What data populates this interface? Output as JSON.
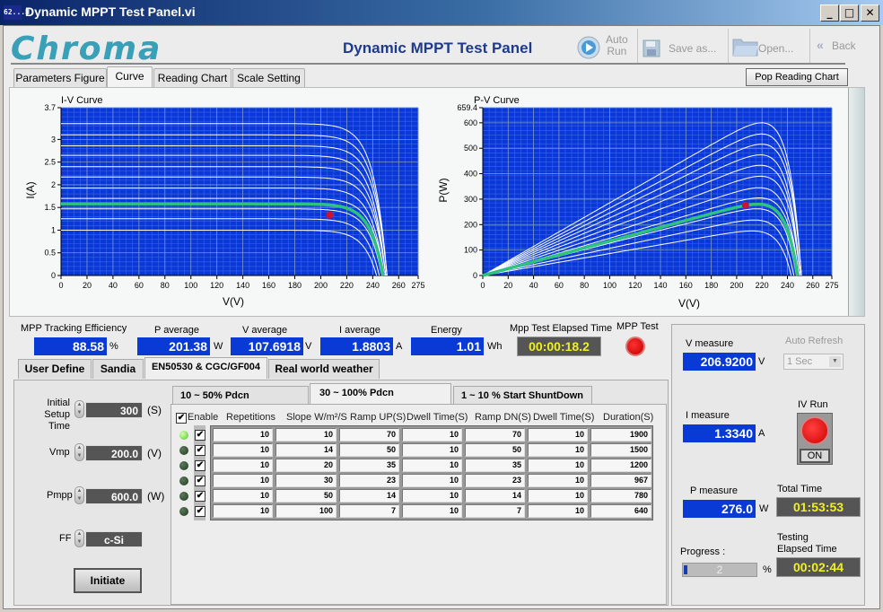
{
  "window": {
    "app_icon_text": "62...H",
    "title": "Dynamic MPPT Test Panel.vi",
    "controls": {
      "minimize": "_",
      "maximize": "□",
      "close": "✕"
    }
  },
  "header": {
    "logo": "Chroma",
    "title": "Dynamic MPPT Test Panel",
    "toolbar": [
      {
        "icon": "play-icon",
        "label_line1": "Auto",
        "label_line2": "Run"
      },
      {
        "icon": "floppy-icon",
        "label": "Save as..."
      },
      {
        "icon": "folder-icon",
        "label": "Open..."
      },
      {
        "icon": "back-chevrons-icon",
        "label": "Back"
      }
    ]
  },
  "main_tabs": [
    "Parameters Figure",
    "Curve",
    "Reading Chart",
    "Scale Setting"
  ],
  "main_tab_active": "Curve",
  "pop_button": "Pop Reading Chart",
  "chart_data": [
    {
      "type": "line",
      "title": "I-V Curve",
      "xlabel": "V(V)",
      "ylabel": "I(A)",
      "xlim": [
        0,
        275
      ],
      "ylim": [
        0,
        3.7
      ],
      "xticks": [
        "0",
        "20",
        "40",
        "60",
        "80",
        "100",
        "120",
        "140",
        "160",
        "180",
        "200",
        "220",
        "240",
        "260",
        "275"
      ],
      "yticks": [
        "0",
        "0.5",
        "1",
        "1.5",
        "2",
        "2.5",
        "3",
        "3.7"
      ],
      "grid": true,
      "background": "#0a38d8",
      "series_isc": [
        1.0,
        1.25,
        1.47,
        1.58,
        1.7,
        1.93,
        2.17,
        2.4,
        2.65,
        2.86,
        3.1,
        3.35
      ],
      "voc": [
        243,
        245,
        247,
        248,
        249,
        249,
        250,
        250,
        250,
        251,
        251,
        251
      ],
      "highlight_series_index": 3,
      "highlight_color": "#2ec27e",
      "marker": {
        "x": 207,
        "y": 1.334,
        "color": "#cc1133"
      }
    },
    {
      "type": "line",
      "title": "P-V Curve",
      "xlabel": "V(V)",
      "ylabel": "P(W)",
      "xlim": [
        0,
        275
      ],
      "ylim": [
        0,
        659.4
      ],
      "xticks": [
        "0",
        "20",
        "40",
        "60",
        "80",
        "100",
        "120",
        "140",
        "160",
        "180",
        "200",
        "220",
        "240",
        "260",
        "275"
      ],
      "yticks": [
        "0",
        "100",
        "200",
        "300",
        "400",
        "500",
        "600",
        "659.4"
      ],
      "grid": true,
      "background": "#0a38d8",
      "series_pmax": [
        175,
        218,
        262,
        280,
        305,
        345,
        390,
        433,
        474,
        516,
        556,
        600
      ],
      "highlight_series_index": 3,
      "highlight_color": "#2ec27e",
      "marker": {
        "x": 207,
        "y": 276,
        "color": "#cc1133"
      }
    }
  ],
  "readouts": {
    "efficiency": {
      "label": "MPP Tracking Efficiency",
      "value": "88.58",
      "unit": "%"
    },
    "p_average": {
      "label": "P average",
      "value": "201.38",
      "unit": "W"
    },
    "v_average": {
      "label": "V average",
      "value": "107.6918",
      "unit": "V"
    },
    "i_average": {
      "label": "I average",
      "value": "1.8803",
      "unit": "A"
    },
    "energy": {
      "label": "Energy",
      "value": "1.01",
      "unit": "Wh"
    },
    "mpp_elapsed": {
      "label": "Mpp Test Elapsed Time",
      "value": "00:00:18.2"
    },
    "mpp_test": {
      "label": "MPP Test"
    }
  },
  "mode_tabs": [
    "User Define",
    "Sandia",
    "EN50530 & CGC/GF004",
    "Real world weather"
  ],
  "mode_tab_active": "EN50530 & CGC/GF004",
  "setup": {
    "initial_setup_time": {
      "label_line1": "Initial Setup",
      "label_line2": "Time",
      "value": "300",
      "unit": "(S)"
    },
    "vmp": {
      "label": "Vmp",
      "value": "200.0",
      "unit": "(V)"
    },
    "pmpp": {
      "label": "Pmpp",
      "value": "600.0",
      "unit": "(W)"
    },
    "ff": {
      "label": "FF",
      "value": "c-Si"
    },
    "initiate": "Initiate"
  },
  "sub_tabs": [
    "10 ~ 50% Pdcn",
    "30 ~ 100% Pdcn",
    "1 ~ 10 % Start ShuntDown"
  ],
  "sub_tab_active": "30 ~ 100% Pdcn",
  "table": {
    "enable_label": "Enable",
    "columns": [
      "Repetitions",
      "Slope W/m²/S",
      "Ramp UP(S)",
      "Dwell Time(S)",
      "Ramp DN(S)",
      "Dwell Time(S)",
      "Duration(S)"
    ],
    "rows": [
      {
        "active": true,
        "enabled": true,
        "values": [
          "10",
          "10",
          "70",
          "10",
          "70",
          "10",
          "1900"
        ]
      },
      {
        "active": false,
        "enabled": true,
        "values": [
          "10",
          "14",
          "50",
          "10",
          "50",
          "10",
          "1500"
        ]
      },
      {
        "active": false,
        "enabled": true,
        "values": [
          "10",
          "20",
          "35",
          "10",
          "35",
          "10",
          "1200"
        ]
      },
      {
        "active": false,
        "enabled": true,
        "values": [
          "10",
          "30",
          "23",
          "10",
          "23",
          "10",
          "967"
        ]
      },
      {
        "active": false,
        "enabled": true,
        "values": [
          "10",
          "50",
          "14",
          "10",
          "14",
          "10",
          "780"
        ]
      },
      {
        "active": false,
        "enabled": true,
        "values": [
          "10",
          "100",
          "7",
          "10",
          "7",
          "10",
          "640"
        ]
      }
    ]
  },
  "measure": {
    "v": {
      "label": "V measure",
      "value": "206.9200",
      "unit": "V"
    },
    "i": {
      "label": "I measure",
      "value": "1.3340",
      "unit": "A"
    },
    "p": {
      "label": "P measure",
      "value": "276.0",
      "unit": "W"
    },
    "auto_refresh": {
      "label": "Auto Refresh",
      "value": "1 Sec"
    },
    "iv_run": {
      "label": "IV Run",
      "state": "ON"
    },
    "total_time": {
      "label": "Total Time",
      "value": "01:53:53"
    },
    "testing_elapsed": {
      "label_line1": "Testing",
      "label_line2": "Elapsed Time",
      "value": "00:02:44"
    },
    "progress": {
      "label": "Progress :",
      "value": 2,
      "display": "2",
      "unit": "%"
    }
  }
}
